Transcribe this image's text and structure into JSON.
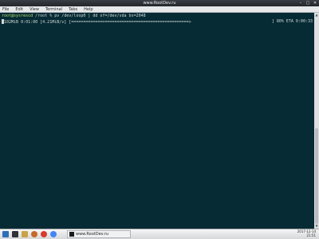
{
  "window": {
    "title": "www.RootDev.ru",
    "controls": [
      "–",
      "▢",
      "✕"
    ]
  },
  "menu": {
    "items": [
      "File",
      "Edit",
      "View",
      "Terminal",
      "Tabs",
      "Help"
    ]
  },
  "terminal": {
    "prompt_user": "root@sysrescd",
    "prompt_path": " /root % ",
    "command": "pv /dev/loop0 | dd of=/dev/sda bs=2048",
    "progress_prefix": "102MiB 0:01:00 [4.21MiB/s] [",
    "progress_bar": "=================================================>",
    "progress_percent": 0.8,
    "progress_suffix": "] 80% ETA 0:00:33"
  },
  "taskbar": {
    "task_label": "www.RootDev.ru",
    "time": "2017-12-14",
    "date": "21:51"
  },
  "colors": {
    "terminal_bg": "#062b35",
    "prompt_user": "#b8e36b",
    "terminal_text": "#d4d9d6"
  },
  "icons": {
    "taskbar": [
      "menu-icon",
      "terminal-icon",
      "folder-icon",
      "firefox-icon",
      "settings-icon",
      "chrome-icon"
    ]
  }
}
